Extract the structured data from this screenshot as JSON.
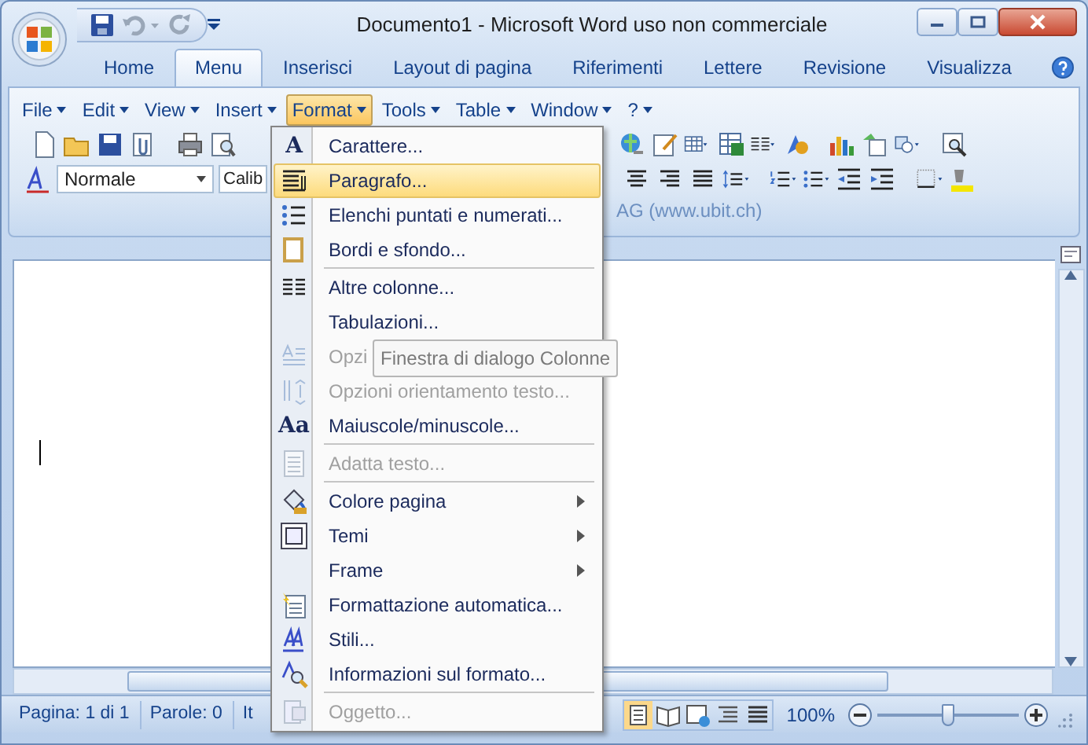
{
  "window": {
    "title": "Documento1 - Microsoft Word uso non commerciale"
  },
  "tabs": [
    {
      "label": "Home",
      "selected": false
    },
    {
      "label": "Menu",
      "selected": true
    },
    {
      "label": "Inserisci",
      "selected": false
    },
    {
      "label": "Layout di pagina",
      "selected": false
    },
    {
      "label": "Riferimenti",
      "selected": false
    },
    {
      "label": "Lettere",
      "selected": false
    },
    {
      "label": "Revisione",
      "selected": false
    },
    {
      "label": "Visualizza",
      "selected": false
    }
  ],
  "menubar": [
    {
      "label": "File",
      "selected": false
    },
    {
      "label": "Edit",
      "selected": false
    },
    {
      "label": "View",
      "selected": false
    },
    {
      "label": "Insert",
      "selected": false
    },
    {
      "label": "Format",
      "selected": true
    },
    {
      "label": "Tools",
      "selected": false
    },
    {
      "label": "Table",
      "selected": false
    },
    {
      "label": "Window",
      "selected": false
    },
    {
      "label": "?",
      "selected": false
    }
  ],
  "toolbar": {
    "style_combo": "Normale",
    "font_combo": "Calib",
    "caption": "AG (www.ubit.ch)"
  },
  "format_menu": {
    "items": [
      {
        "kind": "item",
        "label": "Carattere...",
        "glyph": "A",
        "disabled": false,
        "selected": false
      },
      {
        "kind": "item",
        "label": "Paragrafo...",
        "disabled": false,
        "selected": true
      },
      {
        "kind": "item",
        "label": "Elenchi puntati e numerati...",
        "disabled": false,
        "selected": false
      },
      {
        "kind": "item",
        "label": "Bordi e sfondo...",
        "disabled": false,
        "selected": false
      },
      {
        "kind": "separator"
      },
      {
        "kind": "item",
        "label": "Altre colonne...",
        "disabled": false,
        "selected": false
      },
      {
        "kind": "item",
        "label": "Tabulazioni...",
        "disabled": false,
        "selected": false
      },
      {
        "kind": "item",
        "label": "Opzi",
        "disabled": true,
        "selected": false,
        "tooltip": "Finestra di dialogo Colonne"
      },
      {
        "kind": "item",
        "label": "Opzioni orientamento testo...",
        "disabled": true,
        "selected": false
      },
      {
        "kind": "item",
        "label": "Maiuscole/minuscole...",
        "glyph": "Aa",
        "disabled": false,
        "selected": false
      },
      {
        "kind": "separator"
      },
      {
        "kind": "item",
        "label": "Adatta testo...",
        "disabled": true,
        "selected": false
      },
      {
        "kind": "separator"
      },
      {
        "kind": "submenu",
        "label": "Colore pagina",
        "disabled": false,
        "selected": false
      },
      {
        "kind": "submenu",
        "label": "Temi",
        "disabled": false,
        "selected": false
      },
      {
        "kind": "submenu",
        "label": "Frame",
        "disabled": false,
        "selected": false
      },
      {
        "kind": "item",
        "label": "Formattazione automatica...",
        "disabled": false,
        "selected": false
      },
      {
        "kind": "item",
        "label": "Stili...",
        "disabled": false,
        "selected": false
      },
      {
        "kind": "item",
        "label": "Informazioni sul formato...",
        "disabled": false,
        "selected": false
      },
      {
        "kind": "separator"
      },
      {
        "kind": "item",
        "label": "Oggetto...",
        "disabled": true,
        "selected": false
      }
    ]
  },
  "status_bar": {
    "page": "Pagina: 1 di 1",
    "words": "Parole: 0",
    "language": "It",
    "zoom": "100%",
    "zoom_slider": {
      "level": 0.5
    }
  }
}
